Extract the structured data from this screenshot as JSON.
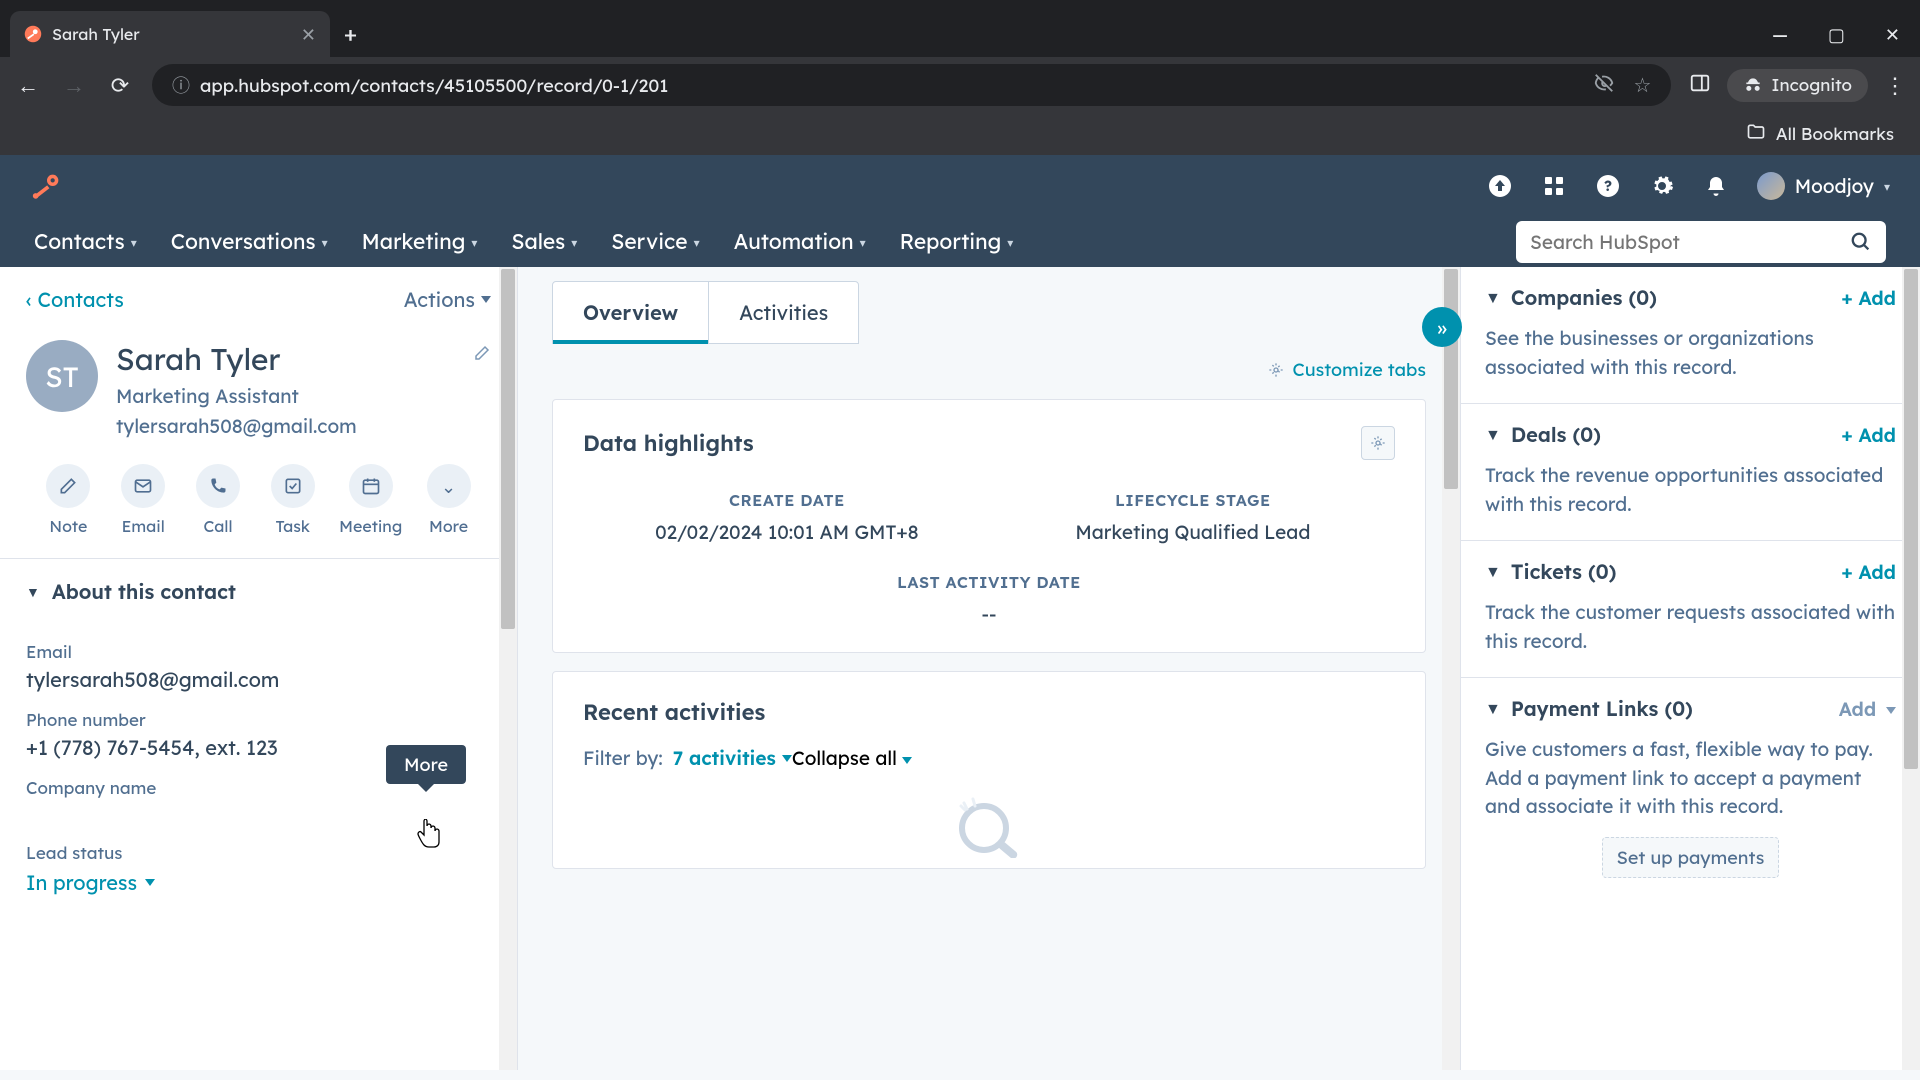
{
  "browser": {
    "tab_title": "Sarah Tyler",
    "url": "app.hubspot.com/contacts/45105500/record/0-1/201",
    "incognito_label": "Incognito",
    "all_bookmarks": "All Bookmarks"
  },
  "header": {
    "user_name": "Moodjoy"
  },
  "nav": {
    "items": [
      "Contacts",
      "Conversations",
      "Marketing",
      "Sales",
      "Service",
      "Automation",
      "Reporting"
    ],
    "search_placeholder": "Search HubSpot"
  },
  "left": {
    "back_label": "Contacts",
    "actions_label": "Actions",
    "avatar_initials": "ST",
    "name": "Sarah Tyler",
    "role": "Marketing Assistant",
    "email": "tylersarah508@gmail.com",
    "actions_row": [
      "Note",
      "Email",
      "Call",
      "Task",
      "Meeting",
      "More"
    ],
    "tooltip": "More",
    "about_title": "About this contact",
    "fields": {
      "email_label": "Email",
      "email_value": "tylersarah508@gmail.com",
      "phone_label": "Phone number",
      "phone_value": "+1 (778) 767-5454, ext. 123",
      "company_label": "Company name",
      "company_value": "",
      "lead_label": "Lead status",
      "lead_value": "In progress"
    }
  },
  "center": {
    "tabs": [
      "Overview",
      "Activities"
    ],
    "customize_label": "Customize tabs",
    "data_highlights_title": "Data highlights",
    "dh": {
      "create_label": "CREATE DATE",
      "create_value": "02/02/2024 10:01 AM GMT+8",
      "lifecycle_label": "LIFECYCLE STAGE",
      "lifecycle_value": "Marketing Qualified Lead",
      "last_activity_label": "LAST ACTIVITY DATE",
      "last_activity_value": "--"
    },
    "recent_title": "Recent activities",
    "filter_label": "Filter by:",
    "filter_value": "7 activities",
    "collapse_label": "Collapse all"
  },
  "right": {
    "panels": [
      {
        "title": "Companies (0)",
        "add": "+ Add",
        "body": "See the businesses or organizations associated with this record."
      },
      {
        "title": "Deals (0)",
        "add": "+ Add",
        "body": "Track the revenue opportunities associated with this record."
      },
      {
        "title": "Tickets (0)",
        "add": "+ Add",
        "body": "Track the customer requests associated with this record."
      },
      {
        "title": "Payment Links (0)",
        "add": "Add",
        "body": "Give customers a fast, flexible way to pay. Add a payment link to accept a payment and associate it with this record.",
        "setup": "Set up payments"
      }
    ]
  }
}
